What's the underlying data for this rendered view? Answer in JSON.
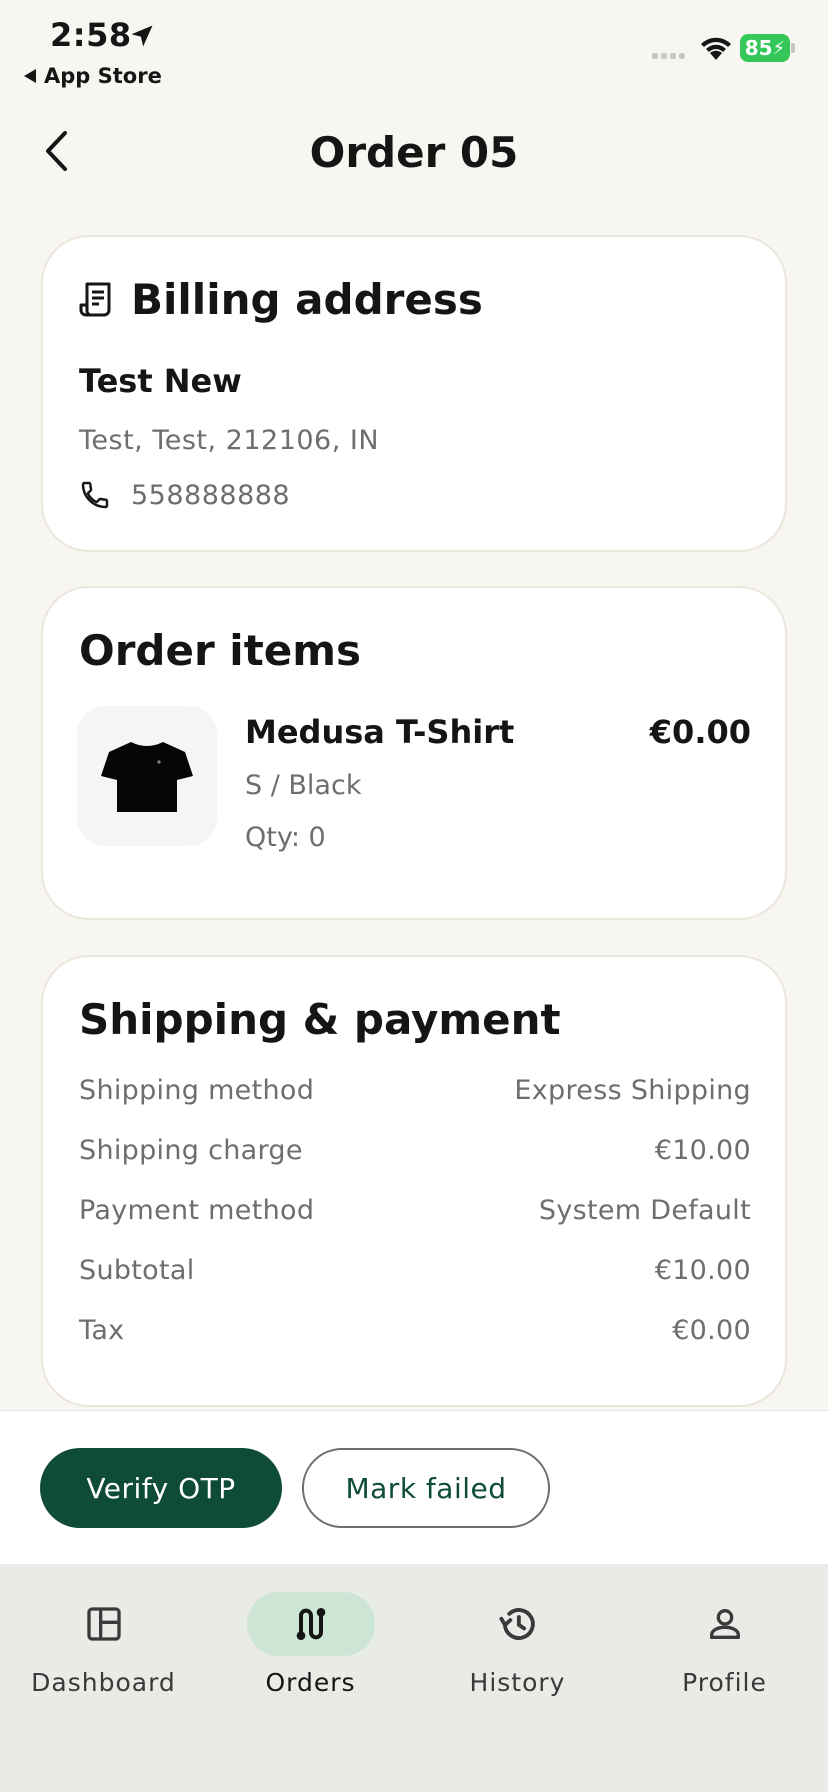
{
  "status_bar": {
    "time": "2:58",
    "back_app": "App Store",
    "battery": "85"
  },
  "header": {
    "title": "Order 05"
  },
  "billing": {
    "title": "Billing address",
    "name": "Test New",
    "address": "Test, Test, 212106, IN",
    "phone": "558888888"
  },
  "items": {
    "title": "Order items",
    "list": [
      {
        "name": "Medusa T-Shirt",
        "variant": "S / Black",
        "qty": "Qty: 0",
        "price": "€0.00"
      }
    ]
  },
  "shipping": {
    "title": "Shipping & payment",
    "rows": [
      {
        "label": "Shipping method",
        "value": "Express Shipping"
      },
      {
        "label": "Shipping charge",
        "value": "€10.00"
      },
      {
        "label": "Payment method",
        "value": "System Default"
      },
      {
        "label": "Subtotal",
        "value": "€10.00"
      },
      {
        "label": "Tax",
        "value": "€0.00"
      }
    ]
  },
  "actions": {
    "primary": "Verify OTP",
    "secondary": "Mark failed"
  },
  "nav": {
    "items": [
      {
        "label": "Dashboard",
        "icon": "dashboard-icon"
      },
      {
        "label": "Orders",
        "icon": "route-icon",
        "active": true
      },
      {
        "label": "History",
        "icon": "history-icon"
      },
      {
        "label": "Profile",
        "icon": "person-icon"
      }
    ]
  },
  "colors": {
    "brand": "#0e4c35",
    "nav_active_bg": "#cde5d4",
    "background": "#f8f6f1",
    "battery": "#34c759"
  }
}
